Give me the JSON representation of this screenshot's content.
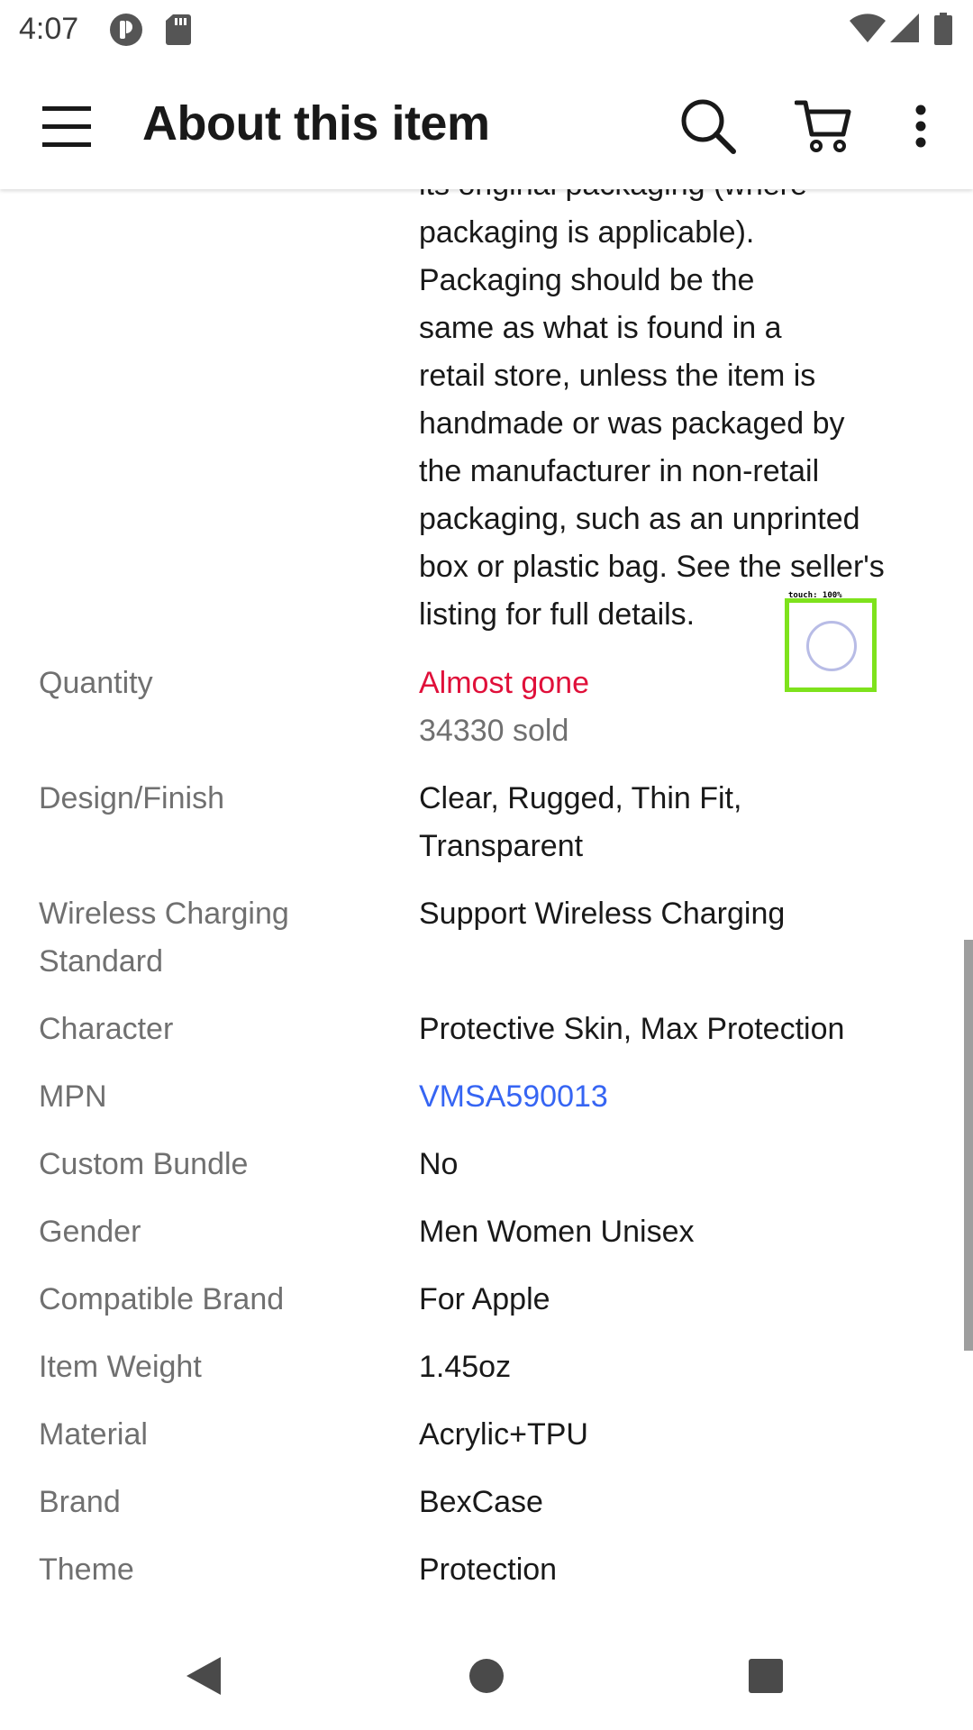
{
  "status_bar": {
    "time": "4:07"
  },
  "app_bar": {
    "title": "About this item",
    "icons": [
      "menu-icon",
      "search-icon",
      "cart-icon",
      "more-vert-icon"
    ]
  },
  "condition_paragraph": [
    "its original packaging (where",
    "packaging is applicable).",
    "Packaging should be the",
    "same as what is found in a",
    "retail store, unless the item is",
    "handmade or was packaged by",
    "the manufacturer in non-retail",
    "packaging, such as an unprinted",
    "box or plastic bag. See the seller's",
    "listing for full details."
  ],
  "specs": [
    {
      "label": [
        "Quantity"
      ],
      "value": [
        "Almost gone"
      ],
      "sub_value": "34330 sold"
    },
    {
      "label": [
        "Design/Finish"
      ],
      "value": [
        "Clear, Rugged, Thin Fit,",
        "Transparent"
      ]
    },
    {
      "label": [
        "Wireless Charging",
        "Standard"
      ],
      "value": [
        "Support Wireless Charging"
      ]
    },
    {
      "label": [
        "Character"
      ],
      "value": [
        "Protective Skin, Max Protection"
      ]
    },
    {
      "label": [
        "MPN"
      ],
      "value": [
        "VMSA590013"
      ]
    },
    {
      "label": [
        "Custom Bundle"
      ],
      "value": [
        "No"
      ]
    },
    {
      "label": [
        "Gender"
      ],
      "value": [
        "Men Women Unisex"
      ]
    },
    {
      "label": [
        "Compatible Brand"
      ],
      "value": [
        "For Apple"
      ]
    },
    {
      "label": [
        "Item Weight"
      ],
      "value": [
        "1.45oz"
      ]
    },
    {
      "label": [
        "Material"
      ],
      "value": [
        "Acrylic+TPU"
      ]
    },
    {
      "label": [
        "Brand"
      ],
      "value": [
        "BexCase"
      ]
    },
    {
      "label": [
        "Theme"
      ],
      "value": [
        "Protection"
      ]
    }
  ],
  "touch_indicator": {
    "label": "touch: 100%"
  },
  "colors": {
    "alert_red": "#e0103a",
    "link_blue": "#3665f3",
    "label_gray": "#707070",
    "text_dark": "#191919",
    "touch_green": "#7ee21c"
  }
}
